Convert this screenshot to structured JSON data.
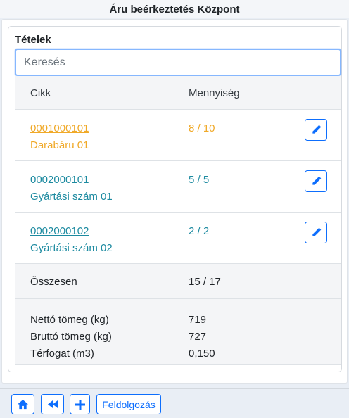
{
  "header": {
    "title": "Áru beérkeztetés Központ"
  },
  "section": {
    "title": "Tételek"
  },
  "search": {
    "placeholder": "Keresés",
    "value": ""
  },
  "table": {
    "columns": {
      "item": "Cikk",
      "quantity": "Mennyiség"
    },
    "rows": [
      {
        "code": "0001000101",
        "name": "Darabáru 01",
        "quantity": "8 / 10",
        "color": "#f0a928"
      },
      {
        "code": "0002000101",
        "name": "Gyártási szám 01",
        "quantity": "5 / 5",
        "color": "#1c8aa0"
      },
      {
        "code": "0002000102",
        "name": "Gyártási szám 02",
        "quantity": "2 / 2",
        "color": "#1c8aa0"
      }
    ],
    "total": {
      "label": "Összesen",
      "value": "15 / 17"
    },
    "stats": [
      {
        "label": "Nettó tömeg (kg)",
        "value": "719"
      },
      {
        "label": "Bruttó tömeg (kg)",
        "value": "727"
      },
      {
        "label": "Térfogat (m3)",
        "value": "0,150"
      }
    ]
  },
  "toolbar": {
    "home_icon": "home-icon",
    "back_icon": "fast-backward-icon",
    "add_icon": "plus-icon",
    "process_label": "Feldolgozás"
  },
  "colors": {
    "primary": "#0d6efd",
    "warning": "#f0a928",
    "info": "#1c8aa0"
  }
}
